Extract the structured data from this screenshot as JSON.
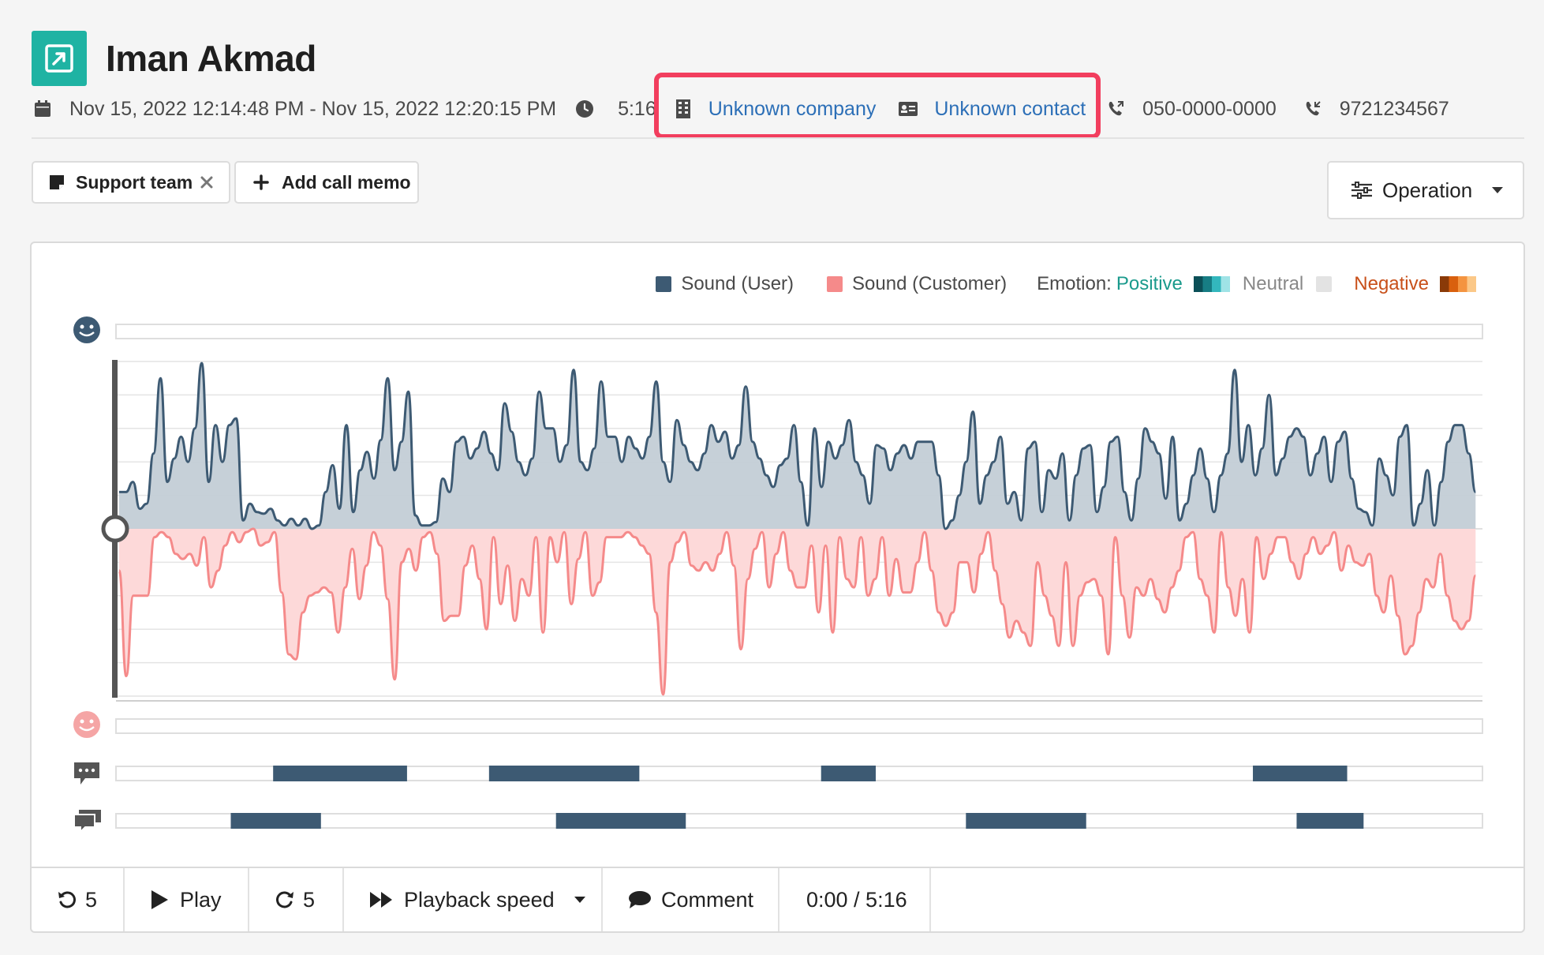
{
  "header": {
    "title": "Iman Akmad",
    "date_range": "Nov 15, 2022 12:14:48 PM - Nov 15, 2022 12:20:15 PM",
    "duration": "5:16",
    "company": "Unknown company",
    "contact": "Unknown contact",
    "outgoing_number": "050-0000-0000",
    "incoming_number": "9721234567"
  },
  "toolbar": {
    "tag_label": "Support team",
    "add_memo_label": "Add call memo",
    "operation_label": "Operation"
  },
  "legend": {
    "user_label": "Sound (User)",
    "customer_label": "Sound (Customer)",
    "emotion_label": "Emotion:",
    "positive_label": "Positive",
    "neutral_label": "Neutral",
    "negative_label": "Negative"
  },
  "colors": {
    "user": "#3d5a73",
    "user_fill": "#c3ced6",
    "customer": "#f58a8a",
    "customer_fill": "#fdd9d9",
    "highlight": "#f23e5e",
    "accent": "#1fb3a3",
    "link": "#2c6fb7"
  },
  "chart_data": {
    "type": "area",
    "title": "",
    "xlabel": "",
    "ylabel": "",
    "ylim": [
      -1,
      1
    ],
    "grid": true,
    "legend_position": "top-right",
    "series": [
      {
        "name": "Sound (User)",
        "values": [
          0.22,
          0.22,
          0.28,
          0.12,
          0.15,
          0.45,
          0.9,
          0.28,
          0.42,
          0.55,
          0.4,
          0.6,
          0.99,
          0.28,
          0.62,
          0.4,
          0.62,
          0.66,
          0.05,
          0.15,
          0.1,
          0.09,
          0.12,
          0.05,
          0.02,
          0.06,
          0.02,
          0.06,
          0.0,
          0.02,
          0.22,
          0.38,
          0.12,
          0.62,
          0.1,
          0.35,
          0.46,
          0.3,
          0.53,
          0.9,
          0.35,
          0.52,
          0.82,
          0.08,
          0.02,
          0.02,
          0.04,
          0.3,
          0.22,
          0.52,
          0.55,
          0.42,
          0.48,
          0.58,
          0.45,
          0.35,
          0.75,
          0.58,
          0.4,
          0.32,
          0.42,
          0.82,
          0.6,
          0.6,
          0.4,
          0.5,
          0.95,
          0.4,
          0.35,
          0.48,
          0.88,
          0.55,
          0.55,
          0.4,
          0.55,
          0.48,
          0.42,
          0.55,
          0.88,
          0.4,
          0.28,
          0.65,
          0.5,
          0.4,
          0.35,
          0.45,
          0.62,
          0.52,
          0.58,
          0.42,
          0.5,
          0.85,
          0.52,
          0.42,
          0.32,
          0.25,
          0.38,
          0.42,
          0.62,
          0.28,
          0.02,
          0.6,
          0.25,
          0.52,
          0.42,
          0.5,
          0.65,
          0.4,
          0.32,
          0.15,
          0.5,
          0.48,
          0.35,
          0.45,
          0.5,
          0.42,
          0.52,
          0.52,
          0.52,
          0.32,
          0.0,
          0.05,
          0.2,
          0.4,
          0.7,
          0.15,
          0.32,
          0.4,
          0.55,
          0.15,
          0.22,
          0.05,
          0.48,
          0.52,
          0.1,
          0.35,
          0.3,
          0.45,
          0.05,
          0.32,
          0.48,
          0.5,
          0.1,
          0.25,
          0.52,
          0.55,
          0.22,
          0.05,
          0.3,
          0.6,
          0.52,
          0.45,
          0.18,
          0.55,
          0.05,
          0.15,
          0.32,
          0.48,
          0.3,
          0.1,
          0.32,
          0.45,
          0.95,
          0.4,
          0.62,
          0.32,
          0.48,
          0.8,
          0.32,
          0.42,
          0.55,
          0.6,
          0.55,
          0.32,
          0.45,
          0.55,
          0.28,
          0.52,
          0.58,
          0.3,
          0.12,
          0.1,
          0.02,
          0.42,
          0.32,
          0.2,
          0.55,
          0.62,
          0.02,
          0.15,
          0.35,
          0.02,
          0.28,
          0.52,
          0.62,
          0.62,
          0.45,
          0.22
        ]
      },
      {
        "name": "Sound (Customer)",
        "values": [
          -0.25,
          -0.88,
          -0.4,
          -0.4,
          -0.4,
          -0.05,
          -0.02,
          -0.05,
          -0.15,
          -0.18,
          -0.15,
          -0.22,
          -0.05,
          -0.35,
          -0.25,
          -0.1,
          -0.02,
          -0.08,
          -0.02,
          0.0,
          -0.1,
          -0.08,
          -0.02,
          -0.38,
          -0.75,
          -0.78,
          -0.5,
          -0.4,
          -0.38,
          -0.35,
          -0.38,
          -0.62,
          -0.35,
          -0.12,
          -0.42,
          -0.22,
          -0.02,
          -0.1,
          -0.42,
          -0.9,
          -0.2,
          -0.12,
          -0.25,
          -0.05,
          -0.02,
          -0.15,
          -0.55,
          -0.52,
          -0.52,
          -0.22,
          -0.1,
          -0.3,
          -0.6,
          -0.05,
          -0.45,
          -0.22,
          -0.55,
          -0.3,
          -0.4,
          -0.05,
          -0.62,
          -0.05,
          -0.2,
          -0.02,
          -0.45,
          -0.18,
          -0.02,
          -0.4,
          -0.32,
          -0.05,
          -0.05,
          -0.05,
          -0.02,
          -0.05,
          -0.1,
          -0.15,
          -0.5,
          -0.99,
          -0.2,
          -0.08,
          -0.02,
          -0.22,
          -0.25,
          -0.2,
          -0.25,
          -0.15,
          -0.02,
          -0.22,
          -0.72,
          -0.3,
          -0.12,
          -0.02,
          -0.35,
          -0.15,
          -0.02,
          -0.25,
          -0.35,
          -0.35,
          -0.1,
          -0.5,
          -0.1,
          -0.62,
          -0.05,
          -0.3,
          -0.35,
          -0.05,
          -0.4,
          -0.3,
          -0.05,
          -0.4,
          -0.18,
          -0.38,
          -0.38,
          -0.2,
          -0.02,
          -0.25,
          -0.5,
          -0.58,
          -0.5,
          -0.2,
          -0.2,
          -0.38,
          -0.15,
          -0.02,
          -0.25,
          -0.45,
          -0.65,
          -0.55,
          -0.62,
          -0.7,
          -0.2,
          -0.4,
          -0.52,
          -0.7,
          -0.2,
          -0.7,
          -0.4,
          -0.32,
          -0.3,
          -0.4,
          -0.75,
          -0.05,
          -0.4,
          -0.65,
          -0.35,
          -0.4,
          -0.3,
          -0.42,
          -0.5,
          -0.35,
          -0.25,
          -0.05,
          -0.02,
          -0.3,
          -0.4,
          -0.62,
          -0.02,
          -0.35,
          -0.52,
          -0.3,
          -0.62,
          -0.05,
          -0.3,
          -0.15,
          -0.05,
          -0.05,
          -0.2,
          -0.3,
          -0.15,
          -0.05,
          -0.15,
          -0.1,
          -0.02,
          -0.25,
          -0.1,
          -0.2,
          -0.22,
          -0.15,
          -0.4,
          -0.5,
          -0.28,
          -0.52,
          -0.75,
          -0.7,
          -0.5,
          -0.3,
          -0.35,
          -0.15,
          -0.4,
          -0.55,
          -0.6,
          -0.55,
          -0.28
        ]
      }
    ],
    "talk_segments": {
      "track_3": [
        [
          0.115,
          0.213
        ],
        [
          0.273,
          0.383
        ],
        [
          0.516,
          0.556
        ],
        [
          0.832,
          0.901
        ]
      ],
      "track_4": [
        [
          0.084,
          0.15
        ],
        [
          0.322,
          0.417
        ],
        [
          0.622,
          0.71
        ],
        [
          0.864,
          0.913
        ]
      ]
    }
  },
  "player": {
    "rewind_label": "5",
    "play_label": "Play",
    "forward_label": "5",
    "speed_label": "Playback speed",
    "comment_label": "Comment",
    "time_label": "0:00 / 5:16"
  }
}
